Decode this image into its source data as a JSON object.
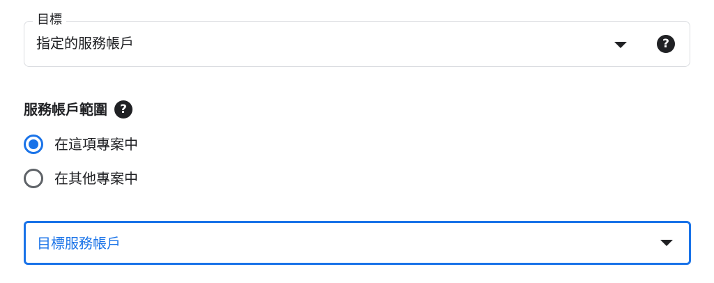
{
  "target": {
    "label": "目標",
    "value": "指定的服務帳戶",
    "arrow_icon": "arrow-drop-down-icon",
    "help_icon": "help-circle-icon",
    "help_glyph": "?"
  },
  "scope": {
    "title": "服務帳戶範圍",
    "help_glyph": "?",
    "options": [
      {
        "label": "在這項專案中",
        "selected": true
      },
      {
        "label": "在其他專案中",
        "selected": false
      }
    ]
  },
  "service_account": {
    "placeholder": "目標服務帳戶",
    "arrow_icon": "arrow-drop-down-icon"
  },
  "colors": {
    "accent": "#1a73e8",
    "text": "#202124",
    "outline": "#dadce0",
    "radio_unselected": "#5f6368"
  }
}
